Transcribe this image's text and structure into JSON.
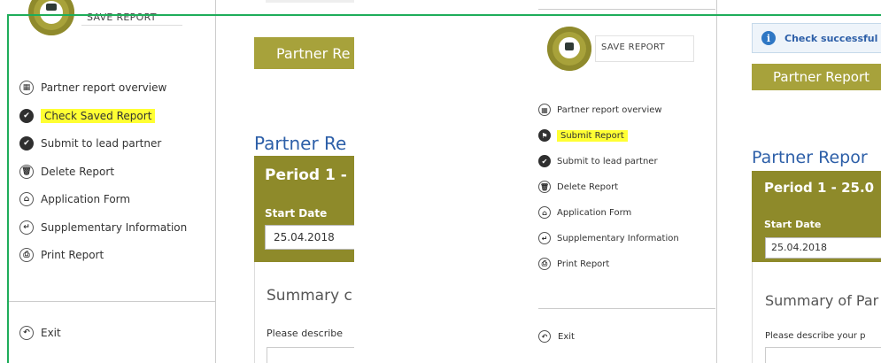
{
  "left": {
    "save_label": "SAVE REPORT",
    "nav": [
      {
        "icon": "grid-icon",
        "glyph": "▦",
        "label": "Partner report overview",
        "filled": false,
        "highlight": false
      },
      {
        "icon": "check-icon",
        "glyph": "✔",
        "label": "Check Saved Report",
        "filled": true,
        "highlight": true
      },
      {
        "icon": "check-icon",
        "glyph": "✔",
        "label": "Submit to lead partner",
        "filled": true,
        "highlight": false
      },
      {
        "icon": "trash-icon",
        "glyph": "🗑",
        "label": "Delete Report",
        "filled": false,
        "highlight": false
      },
      {
        "icon": "bank-icon",
        "glyph": "⌂",
        "label": "Application Form",
        "filled": false,
        "highlight": false
      },
      {
        "icon": "arrow-icon",
        "glyph": "↵",
        "label": "Supplementary Information",
        "filled": false,
        "highlight": false
      },
      {
        "icon": "print-icon",
        "glyph": "⎙",
        "label": "Print Report",
        "filled": false,
        "highlight": false
      }
    ],
    "exit_label": "Exit",
    "content": {
      "bar_text": "Partner Re",
      "title": "Partner Re",
      "period": "Period 1 -",
      "start_label": "Start Date",
      "start_value": "25.04.2018",
      "summary": "Summary c",
      "describe": "Please describe"
    }
  },
  "right": {
    "save_label": "SAVE REPORT",
    "nav": [
      {
        "icon": "grid-icon",
        "glyph": "▦",
        "label": "Partner report overview",
        "filled": false,
        "highlight": false
      },
      {
        "icon": "flag-icon",
        "glyph": "⚑",
        "label": "Submit Report",
        "filled": true,
        "highlight": true
      },
      {
        "icon": "check-icon",
        "glyph": "✔",
        "label": "Submit to lead partner",
        "filled": true,
        "highlight": false
      },
      {
        "icon": "trash-icon",
        "glyph": "🗑",
        "label": "Delete Report",
        "filled": false,
        "highlight": false
      },
      {
        "icon": "bank-icon",
        "glyph": "⌂",
        "label": "Application Form",
        "filled": false,
        "highlight": false
      },
      {
        "icon": "arrow-icon",
        "glyph": "↵",
        "label": "Supplementary Information",
        "filled": false,
        "highlight": false
      },
      {
        "icon": "print-icon",
        "glyph": "⎙",
        "label": "Print Report",
        "filled": false,
        "highlight": false
      }
    ],
    "exit_label": "Exit",
    "content": {
      "info": "Check successful",
      "bar_text": "Partner Report",
      "title": "Partner Repor",
      "period": "Period 1 - 25.0",
      "start_label": "Start Date",
      "start_value": "25.04.2018",
      "summary": "Summary of Par",
      "describe": "Please describe your p"
    }
  },
  "colors": {
    "olive": "#a7a23b",
    "olive_dark": "#8e8a2a",
    "highlight": "#ffff33",
    "frame": "#1fad5a",
    "title_blue": "#2d5fa8"
  }
}
